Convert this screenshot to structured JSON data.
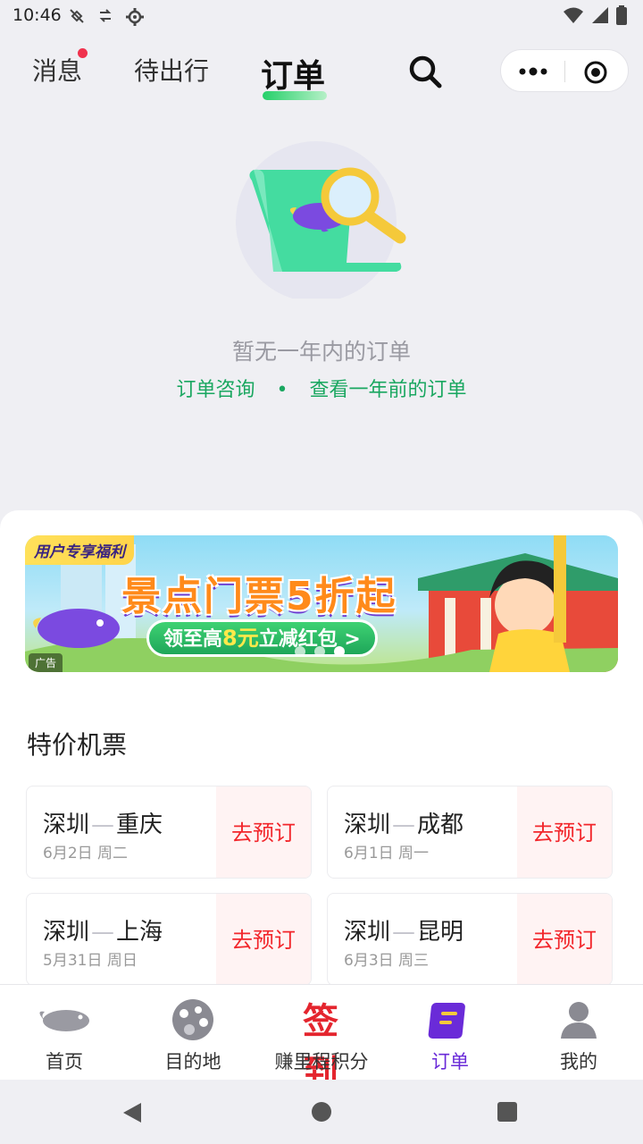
{
  "status_bar": {
    "time": "10:46"
  },
  "top_nav": {
    "tabs": [
      {
        "label": "消息",
        "has_dot": true
      },
      {
        "label": "待出行"
      },
      {
        "label": "订单",
        "active": true
      }
    ]
  },
  "empty_state": {
    "message": "暂无一年内的订单",
    "link_consult": "订单咨询",
    "separator": "•",
    "link_older": "查看一年前的订单"
  },
  "banner": {
    "tag": "用户专享福利",
    "headline": "景点门票5折起",
    "pill_prefix": "领至高",
    "pill_amount": "8元",
    "pill_suffix": "立减红包 >",
    "ad_label": "广告"
  },
  "section": {
    "title": "特价机票"
  },
  "flights": [
    {
      "from": "深圳",
      "to": "重庆",
      "date": "6月2日 周二",
      "action": "去预订"
    },
    {
      "from": "深圳",
      "to": "成都",
      "date": "6月1日 周一",
      "action": "去预订"
    },
    {
      "from": "深圳",
      "to": "上海",
      "date": "5月31日 周日",
      "action": "去预订"
    },
    {
      "from": "深圳",
      "to": "昆明",
      "date": "6月3日 周三",
      "action": "去预订"
    }
  ],
  "tabbar": {
    "items": [
      {
        "label": "首页",
        "icon": "whale-icon"
      },
      {
        "label": "目的地",
        "icon": "palette-icon"
      },
      {
        "label": "赚里程积分",
        "icon": "signin-icon",
        "badge_text": "签到"
      },
      {
        "label": "订单",
        "icon": "order-icon",
        "active": true
      },
      {
        "label": "我的",
        "icon": "profile-icon"
      }
    ]
  },
  "colors": {
    "accent_green": "#1aa760",
    "accent_purple": "#6a2bd8",
    "book_red": "#f2272c"
  }
}
